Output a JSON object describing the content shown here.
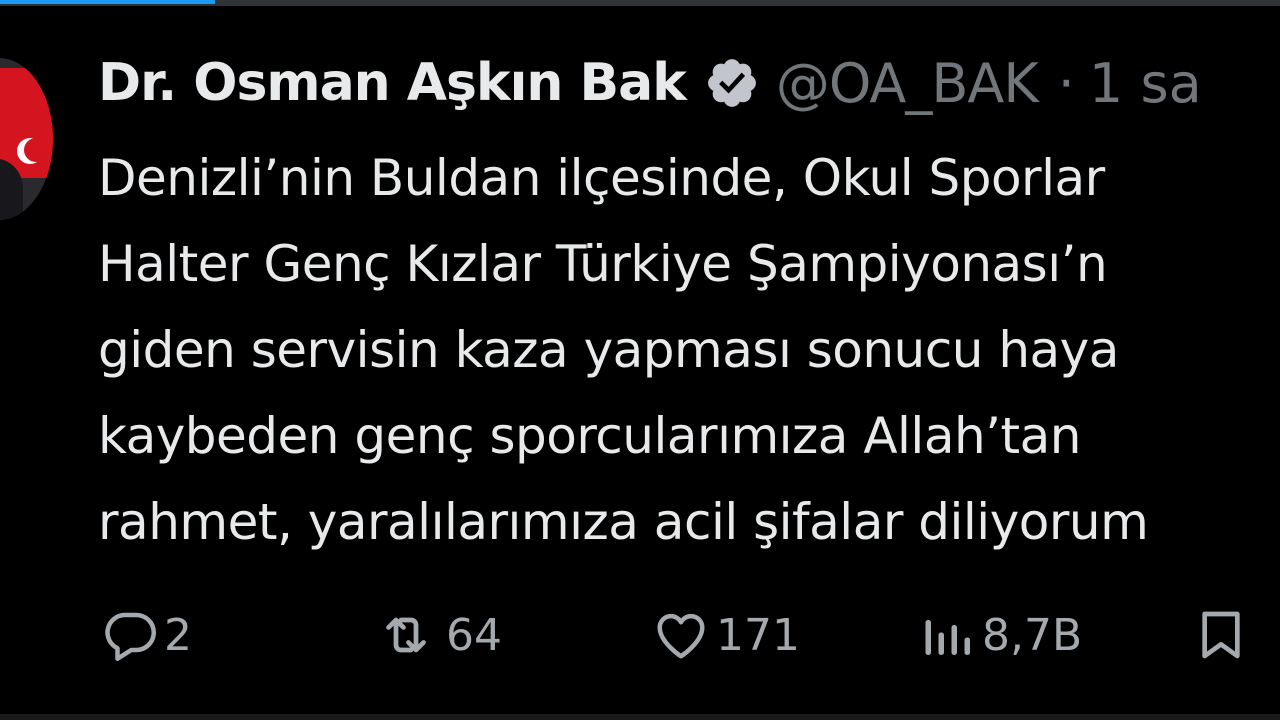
{
  "tweet": {
    "author_name": "Dr. Osman Aşkın Bak",
    "handle": "@OA_BAK",
    "separator": "·",
    "time": "1 sa",
    "text_lines": [
      "Denizli’nin Buldan ilçesinde, Okul Sporlar",
      "Halter Genç Kızlar Türkiye Şampiyonası’n",
      "giden servisin kaza yapması sonucu haya",
      "kaybeden genç sporcularımıza Allah’tan",
      "rahmet, yaralılarımıza acil şifalar diliyorum"
    ]
  },
  "actions": {
    "reply_count": "2",
    "retweet_count": "64",
    "like_count": "171",
    "views_count": "8,7B"
  },
  "icons": {
    "verified": "verified-badge-icon",
    "reply": "reply-icon",
    "retweet": "retweet-icon",
    "like": "heart-icon",
    "views": "views-chart-icon",
    "bookmark": "bookmark-icon"
  },
  "colors": {
    "background": "#000000",
    "text": "#e7e9ea",
    "muted": "#71767b",
    "action": "#a4a9ae",
    "accent": "#1d9bf0",
    "verified_badge": "#c2c6cc"
  }
}
